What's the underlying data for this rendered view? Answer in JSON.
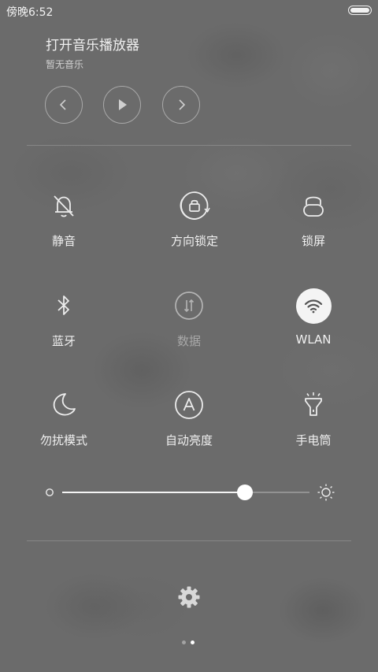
{
  "status_bar": {
    "time": "傍晚6:52"
  },
  "music": {
    "title": "打开音乐播放器",
    "subtitle": "暂无音乐"
  },
  "toggles": [
    {
      "label": "静音",
      "icon": "bell-off-icon",
      "active": false
    },
    {
      "label": "方向锁定",
      "icon": "rotation-lock-icon",
      "active": false
    },
    {
      "label": "锁屏",
      "icon": "lock-icon",
      "active": false
    },
    {
      "label": "蓝牙",
      "icon": "bluetooth-icon",
      "active": false
    },
    {
      "label": "数据",
      "icon": "mobile-data-icon",
      "active": false,
      "disabled": true
    },
    {
      "label": "WLAN",
      "icon": "wifi-icon",
      "active": true
    },
    {
      "label": "勿扰模式",
      "icon": "moon-icon",
      "active": false
    },
    {
      "label": "自动亮度",
      "icon": "auto-brightness-icon",
      "active": false
    },
    {
      "label": "手电筒",
      "icon": "flashlight-icon",
      "active": false
    }
  ],
  "brightness": {
    "level": 0.74
  },
  "pager": {
    "pages": 2,
    "current": 2
  },
  "colors": {
    "background": "#6b6b6b",
    "active_tile": "#f4f4f4",
    "text": "#f0f0f0",
    "disabled_text": "#a8a8a8"
  }
}
